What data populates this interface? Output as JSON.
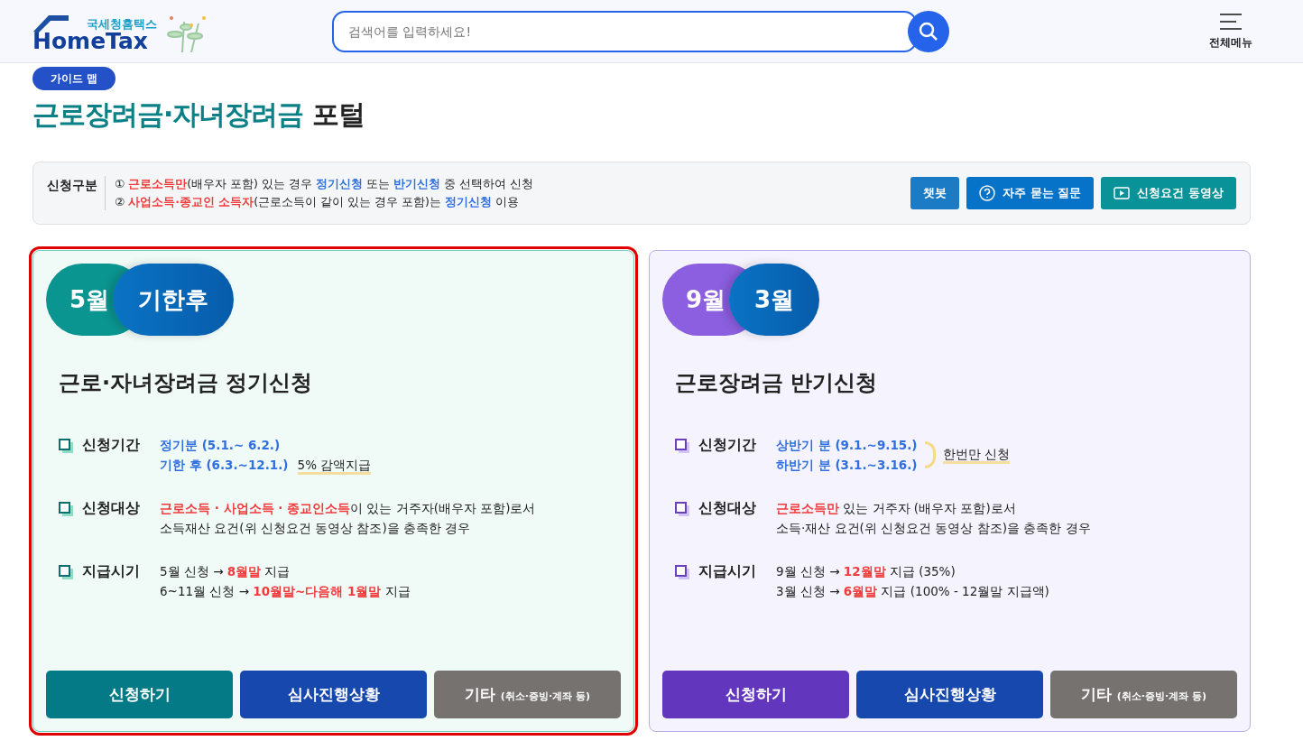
{
  "header": {
    "logo_small": "국세청홈택스",
    "logo_big": "HomeTax",
    "search": {
      "placeholder": "검색어를 입력하세요!"
    },
    "menu_label": "전체메뉴"
  },
  "badge": "가이드 맵",
  "title": [
    {
      "text": "근로장려금·자녀장려금",
      "kind": "accent"
    },
    {
      "text": " 포털",
      "kind": "plain"
    }
  ],
  "notice": {
    "label": "신청구분",
    "lines": [
      [
        {
          "text": "① ",
          "kind": "plain"
        },
        {
          "text": "근로소득만",
          "kind": "warn"
        },
        {
          "text": "(배우자 포함) 있는 경우 ",
          "kind": "plain"
        },
        {
          "text": "정기신청",
          "kind": "link"
        },
        {
          "text": " 또는 ",
          "kind": "plain"
        },
        {
          "text": "반기신청",
          "kind": "link"
        },
        {
          "text": " 중 선택하여 신청",
          "kind": "plain"
        }
      ],
      [
        {
          "text": "② ",
          "kind": "plain"
        },
        {
          "text": "사업소득·종교인 소득자",
          "kind": "warn"
        },
        {
          "text": "(근로소득이 같이 있는 경우 포함)는 ",
          "kind": "plain"
        },
        {
          "text": "정기신청",
          "kind": "link"
        },
        {
          "text": " 이용",
          "kind": "plain"
        }
      ]
    ],
    "buttons": [
      {
        "label": "챗봇",
        "kind": "chat"
      },
      {
        "label": "자주 묻는 질문",
        "kind": "faq"
      },
      {
        "label": "신청요건 동영상",
        "kind": "video"
      }
    ]
  },
  "cards": [
    {
      "kind": "regular",
      "highlighted": true,
      "pill_1": "5월",
      "pill_2": "기한후",
      "title": "근로·자녀장려금 정기신청",
      "rows": [
        {
          "label": "신청기간",
          "lines": [
            [
              {
                "text": "정기분 (5.1.~ 6.2.)",
                "kind": "link"
              }
            ],
            [
              {
                "text": "기한 후 (6.3.~12.1.)",
                "kind": "link"
              },
              {
                "text": "5% 감액지급",
                "kind": "mark"
              }
            ]
          ]
        },
        {
          "label": "신청대상",
          "lines": [
            [
              {
                "text": "근로소득 · 사업소득 · 종교인소득",
                "kind": "warn"
              },
              {
                "text": "이 있는 거주자(배우자 포함)로서",
                "kind": "plain"
              }
            ],
            [
              {
                "text": "소득재산 요건(위 신청요건 동영상 참조)을 충족한 경우",
                "kind": "plain"
              }
            ]
          ]
        },
        {
          "label": "지급시기",
          "lines": [
            [
              {
                "text": "5월 신청 → ",
                "kind": "plain"
              },
              {
                "text": "8월말",
                "kind": "warn"
              },
              {
                "text": " 지급",
                "kind": "plain"
              }
            ],
            [
              {
                "text": "6~11월 신청 → ",
                "kind": "plain"
              },
              {
                "text": "10월말~다음해 1월말",
                "kind": "warn"
              },
              {
                "text": " 지급",
                "kind": "plain"
              }
            ]
          ]
        }
      ],
      "buttons": [
        {
          "label": "신청하기",
          "kind": "apply"
        },
        {
          "label": "심사진행상황",
          "kind": "status"
        },
        {
          "label": "기타",
          "sub": "(취소·증빙·계좌 등)",
          "kind": "other"
        }
      ]
    },
    {
      "kind": "half",
      "highlighted": false,
      "pill_1": "9월",
      "pill_2": "3월",
      "title": "근로장려금 반기신청",
      "rows": [
        {
          "label": "신청기간",
          "lines": [
            [
              {
                "text": "상반기 분 (9.1.~9.15.)",
                "kind": "link"
              }
            ],
            [
              {
                "text": "하반기 분 (3.1.~3.16.)",
                "kind": "link"
              }
            ]
          ],
          "note": "한번만 신청"
        },
        {
          "label": "신청대상",
          "lines": [
            [
              {
                "text": "근로소득만",
                "kind": "warn"
              },
              {
                "text": " 있는 거주자 (배우자 포함)로서",
                "kind": "plain"
              }
            ],
            [
              {
                "text": "소득·재산 요건(위 신청요건 동영상 참조)을 충족한 경우",
                "kind": "plain"
              }
            ]
          ]
        },
        {
          "label": "지급시기",
          "lines": [
            [
              {
                "text": "9월 신청 → ",
                "kind": "plain"
              },
              {
                "text": "12월말",
                "kind": "warn"
              },
              {
                "text": " 지급 (35%)",
                "kind": "plain"
              }
            ],
            [
              {
                "text": "3월 신청 → ",
                "kind": "plain"
              },
              {
                "text": "6월말",
                "kind": "warn"
              },
              {
                "text": " 지급 (100% - 12월말 지급액)",
                "kind": "plain"
              }
            ]
          ]
        }
      ],
      "buttons": [
        {
          "label": "신청하기",
          "kind": "apply"
        },
        {
          "label": "심사진행상황",
          "kind": "status"
        },
        {
          "label": "기타",
          "sub": "(취소·증빙·계좌 등)",
          "kind": "other"
        }
      ]
    }
  ]
}
